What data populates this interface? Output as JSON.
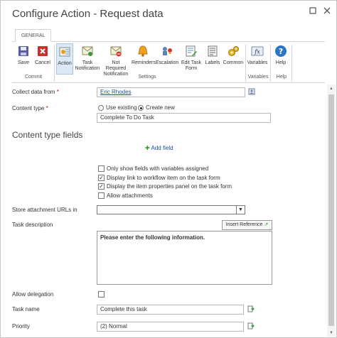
{
  "window": {
    "title": "Configure Action - Request data"
  },
  "ribbon": {
    "tab": "GENERAL",
    "buttons": [
      {
        "id": "save",
        "label": "Save",
        "icon": "save-icon"
      },
      {
        "id": "cancel",
        "label": "Cancel",
        "icon": "cancel-icon"
      },
      {
        "id": "action",
        "label": "Action",
        "icon": "action-icon"
      },
      {
        "id": "task-notification",
        "label": "Task Notification",
        "icon": "task-notification-icon"
      },
      {
        "id": "not-required-notification",
        "label": "Not Required Notification",
        "icon": "not-required-notification-icon"
      },
      {
        "id": "reminders",
        "label": "Reminders",
        "icon": "bell-icon"
      },
      {
        "id": "escalation",
        "label": "Escalation",
        "icon": "escalation-icon"
      },
      {
        "id": "edit-task-form",
        "label": "Edit Task Form",
        "icon": "edit-form-icon"
      },
      {
        "id": "labels",
        "label": "Labels",
        "icon": "labels-icon"
      },
      {
        "id": "common",
        "label": "Common",
        "icon": "gears-icon"
      },
      {
        "id": "variables",
        "label": "Variables",
        "icon": "variables-icon"
      },
      {
        "id": "help",
        "label": "Help",
        "icon": "help-icon"
      }
    ],
    "groups": {
      "commit": "Commit",
      "settings": "Settings",
      "variables": "Variables",
      "help": "Help"
    }
  },
  "form": {
    "collect_label": "Collect data from",
    "collect_value": "Eric Rhodes",
    "required_mark": "*",
    "content_type_label": "Content type",
    "use_existing": "Use existing",
    "create_new": "Create new",
    "content_type_value": "Complete To Do Task",
    "section_title": "Content type fields",
    "add_field": "Add field",
    "options": [
      {
        "label": "Only show fields with variables assigned",
        "checked": false
      },
      {
        "label": "Display link to workflow item on the task form",
        "checked": true
      },
      {
        "label": "Display the item properties panel on the task form",
        "checked": true
      },
      {
        "label": "Allow attachments",
        "checked": false
      }
    ],
    "store_urls_label": "Store attachment URLs in",
    "task_desc_label": "Task description",
    "insert_reference": "Insert Reference",
    "task_desc_value": "Please enter the following information.",
    "allow_delegation_label": "Allow delegation",
    "task_name_label": "Task name",
    "task_name_value": "Complete this task",
    "priority_label": "Priority",
    "priority_value": "(2) Normal"
  }
}
